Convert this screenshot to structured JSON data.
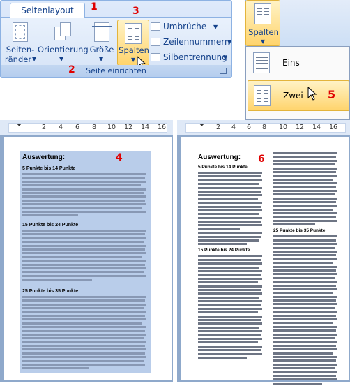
{
  "step_labels": {
    "s1": "1",
    "s2": "2",
    "s3": "3",
    "s4": "4",
    "s5": "5",
    "s6": "6"
  },
  "ribbon": {
    "tab": "Seitenlayout",
    "buttons": {
      "seitenraender": [
        "Seiten-",
        "ränder"
      ],
      "orientierung": "Orientierung",
      "groesse": "Größe",
      "spalten": "Spalten"
    },
    "small_buttons": [
      "Umbrüche",
      "Zeilennummern",
      "Silbentrennung"
    ],
    "group_label": "Seite einrichten"
  },
  "dropdown": {
    "header_label": "Spalten",
    "items": [
      "Eins",
      "Zwei"
    ]
  },
  "left_doc": {
    "ruler_numbers": [
      "2",
      "4",
      "6",
      "8",
      "10",
      "12",
      "14",
      "16"
    ],
    "heading": "Auswertung:",
    "subheads": [
      "5 Punkte bis 14 Punkte",
      "15 Punkte bis 24 Punkte",
      "25 Punkte bis 35 Punkte"
    ]
  },
  "right_doc": {
    "ruler_numbers": [
      "2",
      "4",
      "6",
      "8",
      "10",
      "12",
      "14",
      "16"
    ],
    "heading": "Auswertung:",
    "subheads": [
      "5 Punkte bis 14 Punkte",
      "15 Punkte bis 24 Punkte",
      "25 Punkte bis 35 Punkte"
    ]
  },
  "colors": {
    "ribbon_text": "#15428b",
    "step_red": "#e00000",
    "highlight": "#ffd46d",
    "selection": "#b9cdea",
    "workspace": "#8fa9cb"
  }
}
